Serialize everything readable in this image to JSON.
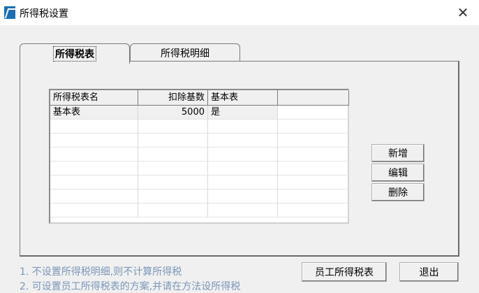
{
  "window": {
    "title": "所得税设置",
    "close_glyph": "✕"
  },
  "tabs": [
    {
      "label": "所得税表",
      "active": true
    },
    {
      "label": "所得税明细",
      "active": false
    }
  ],
  "table": {
    "columns": [
      "所得税表名",
      "扣除基数",
      "基本表",
      ""
    ],
    "rows": [
      [
        "基本表",
        "5000",
        "是",
        ""
      ]
    ]
  },
  "side_buttons": {
    "add": "新增",
    "edit": "编辑",
    "delete": "删除"
  },
  "notes": {
    "line1": "1. 不设置所得税明细,则不计算所得税",
    "line2": "2. 可设置员工所得税表的方案,并请在方法设所得税"
  },
  "bottom_buttons": {
    "employee_tax": "员工所得税表",
    "exit": "退出"
  }
}
